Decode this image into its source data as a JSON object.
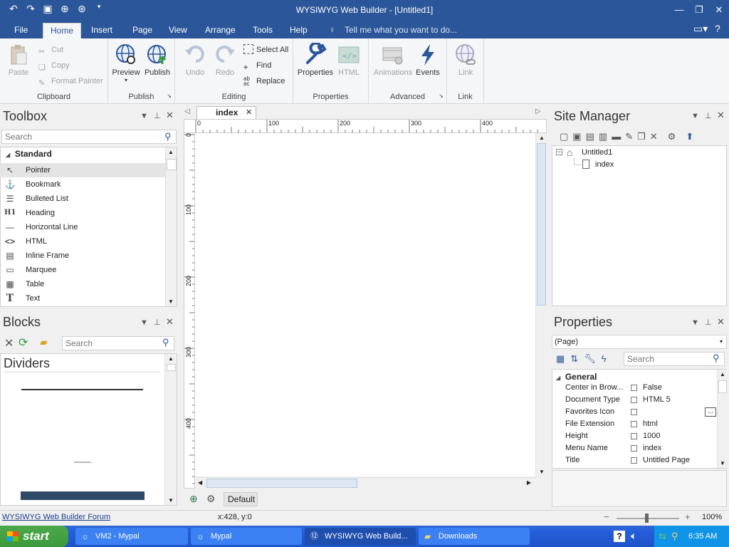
{
  "window": {
    "title": "WYSIWYG Web Builder - [Untitled1]"
  },
  "menu": {
    "tabs": [
      "File",
      "Home",
      "Insert",
      "Page",
      "View",
      "Arrange",
      "Tools",
      "Help"
    ],
    "tellme": "Tell me what you want to do..."
  },
  "ribbon": {
    "clipboard": {
      "paste": "Paste",
      "cut": "Cut",
      "copy": "Copy",
      "format_painter": "Format Painter",
      "label": "Clipboard"
    },
    "publish": {
      "preview": "Preview",
      "publish": "Publish",
      "label": "Publish"
    },
    "editing": {
      "undo": "Undo",
      "redo": "Redo",
      "select_all": "Select All",
      "find": "Find",
      "replace": "Replace",
      "label": "Editing"
    },
    "properties": {
      "properties": "Properties",
      "html": "HTML",
      "label": "Properties"
    },
    "advanced": {
      "animations": "Animations",
      "events": "Events",
      "label": "Advanced"
    },
    "link": {
      "link": "Link",
      "label": "Link"
    }
  },
  "toolbox": {
    "title": "Toolbox",
    "search_placeholder": "Search",
    "category": "Standard",
    "items": [
      "Pointer",
      "Bookmark",
      "Bulleted List",
      "Heading",
      "Horizontal Line",
      "HTML",
      "Inline Frame",
      "Marquee",
      "Table",
      "Text"
    ]
  },
  "blocks": {
    "title": "Blocks",
    "search_placeholder": "Search",
    "category": "Dividers"
  },
  "editor": {
    "tab": "index",
    "ruler_h": [
      "0",
      "100",
      "200",
      "300",
      "400"
    ],
    "ruler_v": [
      "0",
      "100",
      "200",
      "300",
      "400"
    ],
    "layout": "Default"
  },
  "site_manager": {
    "title": "Site Manager",
    "root": "Untitled1",
    "page": "index"
  },
  "properties": {
    "title": "Properties",
    "selector": "(Page)",
    "search_placeholder": "Search",
    "category": "General",
    "rows": [
      {
        "name": "Center in Brow...",
        "value": "False"
      },
      {
        "name": "Document Type",
        "value": "HTML 5"
      },
      {
        "name": "Favorites Icon",
        "value": ""
      },
      {
        "name": "File Extension",
        "value": "html"
      },
      {
        "name": "Height",
        "value": "1000"
      },
      {
        "name": "Menu Name",
        "value": "index"
      },
      {
        "name": "Title",
        "value": "Untitled Page"
      }
    ]
  },
  "statusbar": {
    "link": "WYSIWYG Web Builder Forum",
    "coords": "x:428, y:0",
    "zoom": "100%"
  },
  "taskbar": {
    "start": "start",
    "items": [
      "VM2 - Mypal",
      "Mypal",
      "WYSIWYG Web Build...",
      "Downloads"
    ],
    "clock": "6:35 AM"
  },
  "colors": {
    "accent": "#2b579a",
    "taskbar": "#245edb"
  }
}
